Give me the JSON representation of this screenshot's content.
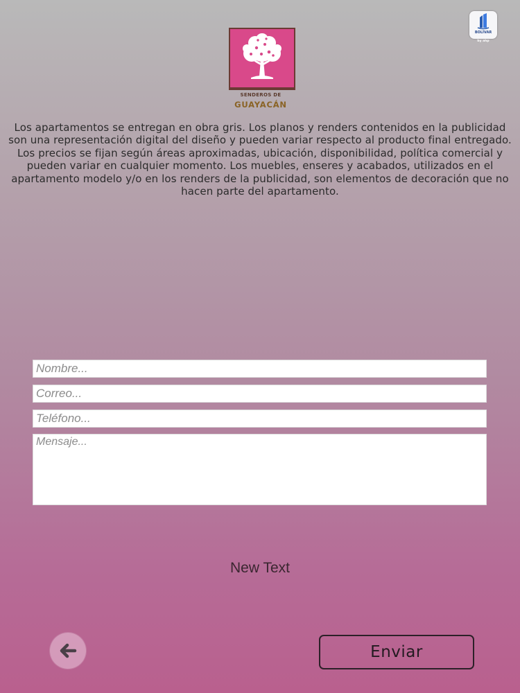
{
  "header": {
    "logo": {
      "line1": "SENDEROS DE",
      "line2": "GUAYACÁN",
      "colors": {
        "pink": "#d9498a",
        "frame": "#6b3a34",
        "gold": "#8a6325"
      }
    },
    "brand_badge": {
      "name": "BOLÍVAR",
      "sub": "by ahp"
    }
  },
  "disclaimer": "Los apartamentos se entregan en obra gris. Los planos y renders contenidos en la publicidad son una representación digital del diseño y pueden variar respecto al producto final entregado. Los precios se fijan según áreas aproximadas, ubicación, disponibilidad, política comercial y pueden variar en cualquier momento. Los muebles, enseres y acabados, utilizados en el apartamento modelo y/o en los renders de la publicidad, son elementos de decoración que no hacen parte del apartamento.",
  "form": {
    "name": {
      "placeholder": "Nombre...",
      "value": ""
    },
    "email": {
      "placeholder": "Correo...",
      "value": ""
    },
    "phone": {
      "placeholder": "Teléfono...",
      "value": ""
    },
    "message": {
      "placeholder": "Mensaje...",
      "value": ""
    }
  },
  "status_text": "New Text",
  "buttons": {
    "back_icon": "arrow-left-icon",
    "send_label": "Enviar"
  },
  "colors": {
    "background_top": "#b9b9b9",
    "background_bottom": "#b9608e",
    "text": "#2b2b2b"
  }
}
